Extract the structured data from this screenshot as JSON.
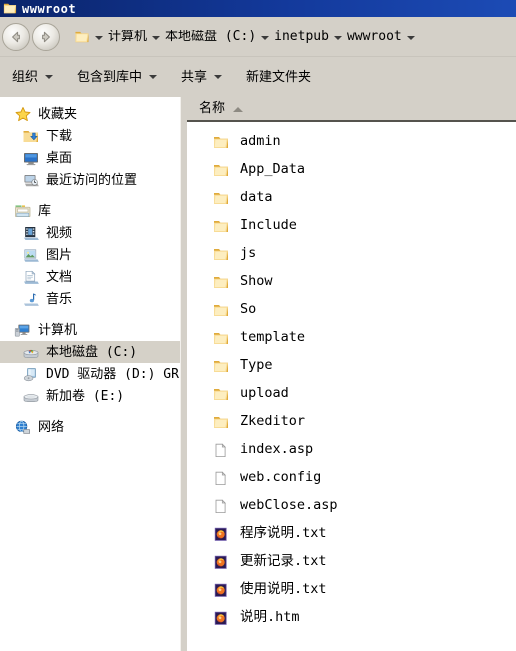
{
  "window": {
    "title": "wwwroot",
    "title_icon": "folder-icon"
  },
  "addressbar": {
    "back_icon": "back-arrow-icon",
    "forward_icon": "forward-arrow-icon",
    "path_icon": "folder-icon",
    "crumbs": [
      {
        "label": "计算机"
      },
      {
        "label": "本地磁盘 (C:)"
      },
      {
        "label": "inetpub"
      },
      {
        "label": "wwwroot"
      }
    ]
  },
  "toolbar": {
    "items": [
      {
        "label": "组织",
        "has_caret": true
      },
      {
        "label": "包含到库中",
        "has_caret": true
      },
      {
        "label": "共享",
        "has_caret": true
      },
      {
        "label": "新建文件夹",
        "has_caret": false
      }
    ]
  },
  "sidebar": {
    "groups": [
      {
        "header": {
          "label": "收藏夹",
          "icon": "star-icon"
        },
        "items": [
          {
            "label": "下载",
            "icon": "downloads-folder-icon",
            "selected": false
          },
          {
            "label": "桌面",
            "icon": "desktop-icon",
            "selected": false
          },
          {
            "label": "最近访问的位置",
            "icon": "recent-places-icon",
            "selected": false
          }
        ]
      },
      {
        "header": {
          "label": "库",
          "icon": "libraries-icon"
        },
        "items": [
          {
            "label": "视频",
            "icon": "videos-icon",
            "selected": false
          },
          {
            "label": "图片",
            "icon": "pictures-icon",
            "selected": false
          },
          {
            "label": "文档",
            "icon": "documents-icon",
            "selected": false
          },
          {
            "label": "音乐",
            "icon": "music-icon",
            "selected": false
          }
        ]
      },
      {
        "header": {
          "label": "计算机",
          "icon": "computer-icon"
        },
        "items": [
          {
            "label": "本地磁盘 (C:)",
            "icon": "local-disk-icon",
            "selected": true
          },
          {
            "label": "DVD 驱动器 (D:) GR",
            "icon": "dvd-drive-icon",
            "selected": false
          },
          {
            "label": "新加卷 (E:)",
            "icon": "hard-drive-icon",
            "selected": false
          }
        ]
      },
      {
        "header": {
          "label": "网络",
          "icon": "network-icon"
        },
        "items": []
      }
    ]
  },
  "content": {
    "column_header": {
      "label": "名称",
      "sort": "ascending",
      "sort_icon": "sort-ascending-icon"
    },
    "files": [
      {
        "name": "admin",
        "icon": "folder-icon"
      },
      {
        "name": "App_Data",
        "icon": "folder-icon"
      },
      {
        "name": "data",
        "icon": "folder-icon"
      },
      {
        "name": "Include",
        "icon": "folder-icon"
      },
      {
        "name": "js",
        "icon": "folder-icon"
      },
      {
        "name": "Show",
        "icon": "folder-icon"
      },
      {
        "name": "So",
        "icon": "folder-icon"
      },
      {
        "name": "template",
        "icon": "folder-icon"
      },
      {
        "name": "Type",
        "icon": "folder-icon"
      },
      {
        "name": "upload",
        "icon": "folder-icon"
      },
      {
        "name": "Zkeditor",
        "icon": "folder-icon"
      },
      {
        "name": "index.asp",
        "icon": "document-icon"
      },
      {
        "name": "web.config",
        "icon": "document-icon"
      },
      {
        "name": "webClose.asp",
        "icon": "document-icon"
      },
      {
        "name": "程序说明.txt",
        "icon": "firefox-icon"
      },
      {
        "name": "更新记录.txt",
        "icon": "firefox-icon"
      },
      {
        "name": "使用说明.txt",
        "icon": "firefox-icon"
      },
      {
        "name": "说明.htm",
        "icon": "firefox-icon"
      }
    ]
  },
  "colors": {
    "titlebar": "#0a246a",
    "chrome": "#d4d0c8",
    "selection": "#d5d1c8",
    "folder": "#f5d98a",
    "firefox_bg": "#2b1b52",
    "firefox_flame": "#ef7321"
  }
}
